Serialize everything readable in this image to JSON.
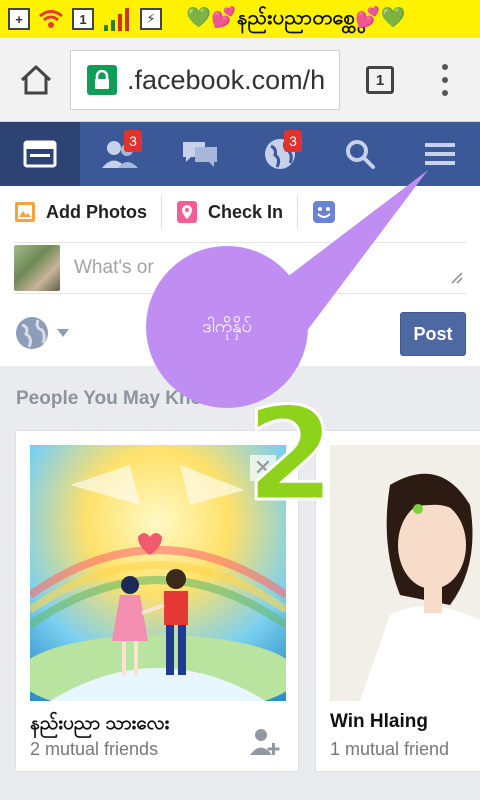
{
  "status_bar": {
    "sim_indicator": "1",
    "banner_text": "နည်းပညာတစ္ထွေ",
    "heart_left": "💚💕",
    "heart_right": "💕💚",
    "accent_color": "#fff200"
  },
  "browser": {
    "url": ".facebook.com/h",
    "tab_count": "1",
    "icons": [
      "home-icon",
      "lock-icon",
      "tabs-icon",
      "overflow-menu-icon"
    ]
  },
  "fb_nav": {
    "items": [
      {
        "name": "news-feed",
        "icon": "newsfeed-icon",
        "badge": ""
      },
      {
        "name": "friend-requests",
        "icon": "friends-icon",
        "badge": "3"
      },
      {
        "name": "messages",
        "icon": "messages-icon",
        "badge": ""
      },
      {
        "name": "notifications",
        "icon": "globe-icon",
        "badge": "3"
      },
      {
        "name": "search",
        "icon": "search-icon",
        "badge": ""
      },
      {
        "name": "menu",
        "icon": "hamburger-icon",
        "badge": ""
      }
    ],
    "bg_color": "#3b5998"
  },
  "composer": {
    "actions": [
      {
        "label": "Add Photos",
        "icon": "photo-icon"
      },
      {
        "label": "Check In",
        "icon": "location-pin-icon"
      },
      {
        "label": "",
        "icon": "emoji-icon"
      }
    ],
    "placeholder": "What's or",
    "post_label": "Post"
  },
  "pymk": {
    "title": "People You May Know",
    "cards": [
      {
        "name": "နည်းပညာ သားလေး",
        "mutual": "2 mutual friends"
      },
      {
        "name": "Win Hlaing",
        "mutual": "1 mutual friend"
      }
    ]
  },
  "overlay": {
    "bubble_text": "ဒါကိုနှိပ်",
    "step_number": "2",
    "bubble_color": "#c08ef2",
    "number_color": "#8ed21c"
  }
}
